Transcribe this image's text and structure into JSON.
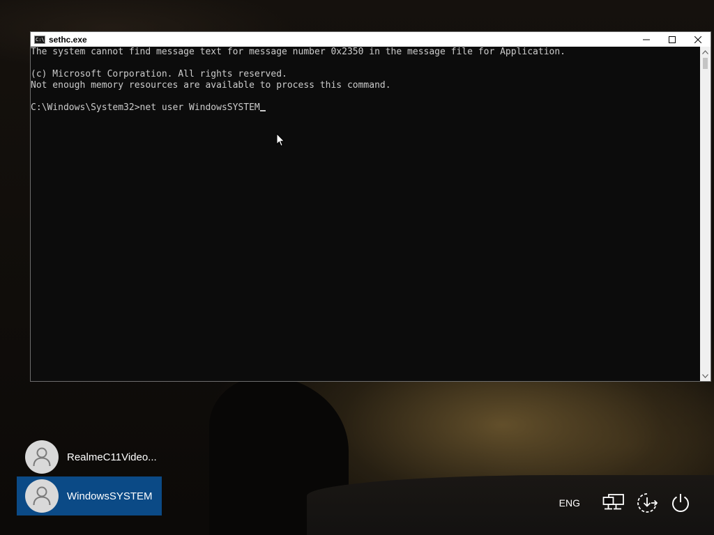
{
  "window": {
    "title": "sethc.exe",
    "icon": "console-icon",
    "icon_glyph": "C:\\",
    "controls": [
      "minimize-icon",
      "maximize-icon",
      "close-icon"
    ]
  },
  "console": {
    "lines": [
      "The system cannot find message text for message number 0x2350 in the message file for Application.",
      "",
      "(c) Microsoft Corporation. All rights reserved.",
      "Not enough memory resources are available to process this command.",
      ""
    ],
    "prompt": "C:\\Windows\\System32>",
    "input": "net user WindowsSYSTEM"
  },
  "lock_screen": {
    "users": [
      {
        "name": "RealmeC11Video...",
        "selected": false,
        "icon": "user-avatar-icon"
      },
      {
        "name": "WindowsSYSTEM",
        "selected": true,
        "icon": "user-avatar-icon"
      }
    ],
    "tray": {
      "language": "ENG",
      "icons": [
        "network-icon",
        "ease-of-access-icon",
        "power-icon"
      ]
    }
  },
  "colors": {
    "console_bg": "#0c0c0c",
    "console_text": "#cccccc",
    "selected_user_bg": "#0b4a86"
  }
}
